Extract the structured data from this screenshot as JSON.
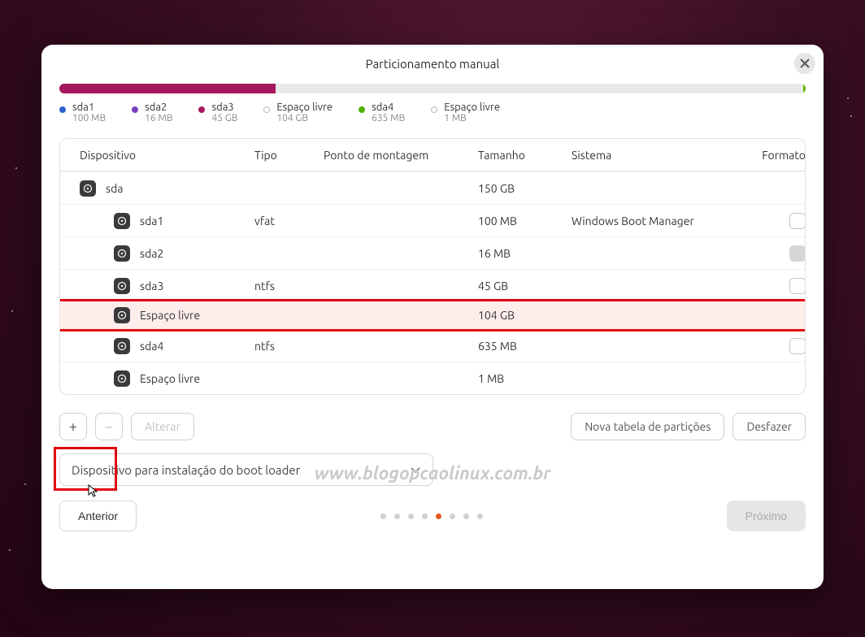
{
  "title": "Particionamento manual",
  "legend": [
    {
      "name": "sda1",
      "size": "100 MB",
      "color": "blue"
    },
    {
      "name": "sda2",
      "size": "16 MB",
      "color": "purple"
    },
    {
      "name": "sda3",
      "size": "45 GB",
      "color": "magenta"
    },
    {
      "name": "Espaço livre",
      "size": "104 GB",
      "color": "grey"
    },
    {
      "name": "sda4",
      "size": "635 MB",
      "color": "green"
    },
    {
      "name": "Espaço livre",
      "size": "1 MB",
      "color": "grey"
    }
  ],
  "columns": {
    "device": "Dispositivo",
    "type": "Tipo",
    "mount": "Ponto de montagem",
    "size": "Tamanho",
    "system": "Sistema",
    "format": "Formato"
  },
  "rows": [
    {
      "kind": "disk",
      "device": "sda",
      "type": "",
      "mount": "",
      "size": "150 GB",
      "system": "",
      "checkbox": "none"
    },
    {
      "kind": "part",
      "device": "sda1",
      "type": "vfat",
      "mount": "",
      "size": "100 MB",
      "system": "Windows Boot Manager",
      "checkbox": "empty"
    },
    {
      "kind": "part",
      "device": "sda2",
      "type": "",
      "mount": "",
      "size": "16 MB",
      "system": "",
      "checkbox": "muted"
    },
    {
      "kind": "part",
      "device": "sda3",
      "type": "ntfs",
      "mount": "",
      "size": "45 GB",
      "system": "",
      "checkbox": "empty"
    },
    {
      "kind": "part",
      "device": "Espaço livre",
      "type": "",
      "mount": "",
      "size": "104 GB",
      "system": "",
      "checkbox": "none",
      "highlight": true
    },
    {
      "kind": "part",
      "device": "sda4",
      "type": "ntfs",
      "mount": "",
      "size": "635 MB",
      "system": "",
      "checkbox": "empty"
    },
    {
      "kind": "part",
      "device": "Espaço livre",
      "type": "",
      "mount": "",
      "size": "1 MB",
      "system": "",
      "checkbox": "none"
    }
  ],
  "actions": {
    "add": "+",
    "remove": "−",
    "change": "Alterar",
    "new_table": "Nova tabela de partições",
    "undo": "Desfazer"
  },
  "boot_select": "Dispositivo para instalação do boot loader",
  "nav": {
    "back": "Anterior",
    "next": "Próximo"
  },
  "progress": {
    "total": 8,
    "active": 5
  },
  "watermark": "www.blogopcaolinux.com.br"
}
